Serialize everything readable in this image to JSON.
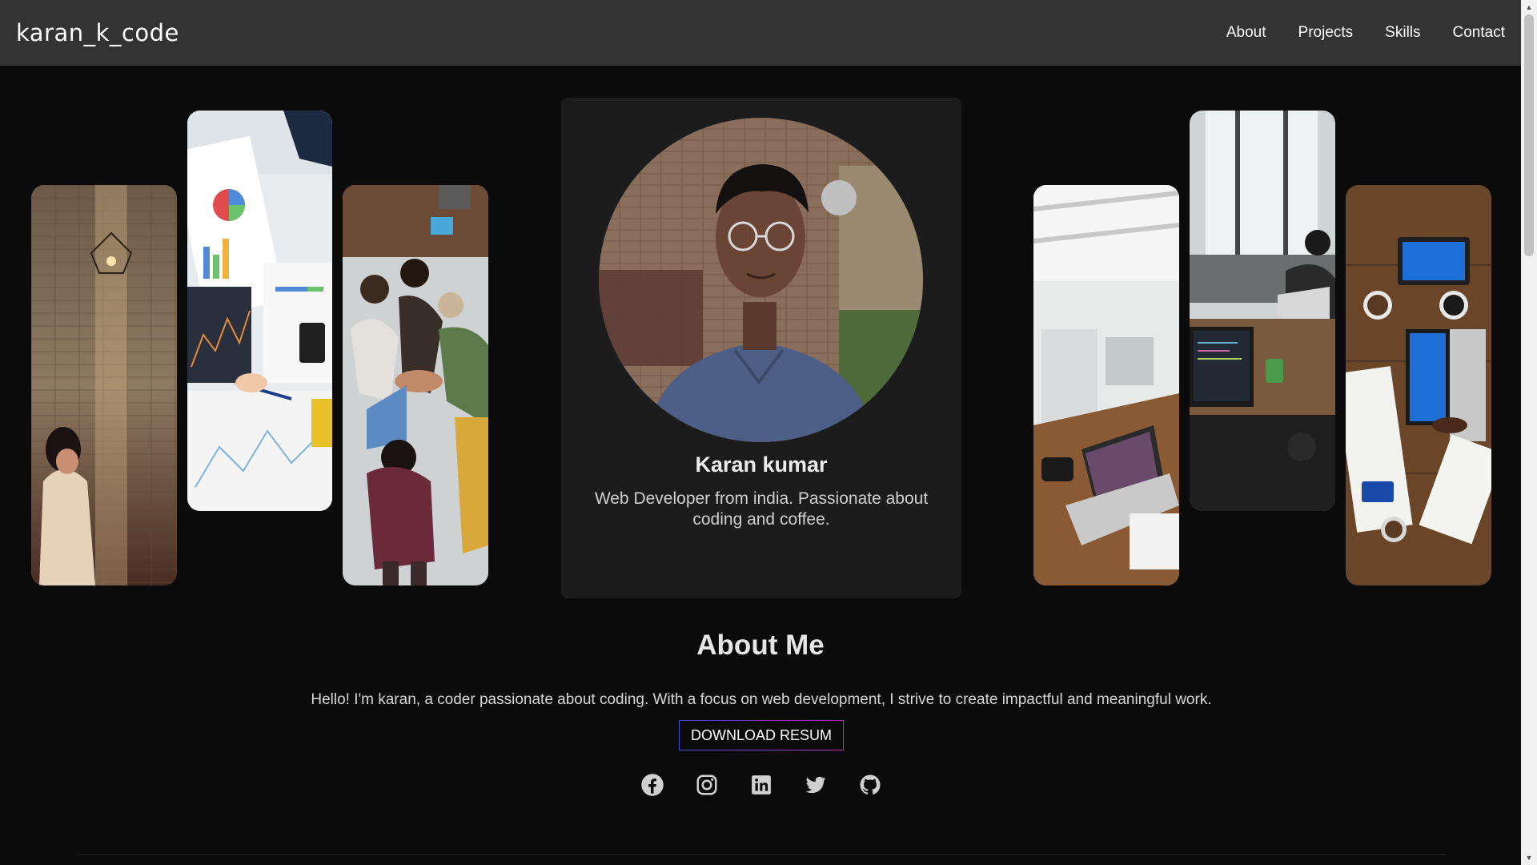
{
  "header": {
    "brand": "karan_k_code",
    "nav": [
      "About",
      "Projects",
      "Skills",
      "Contact"
    ]
  },
  "profile": {
    "name": "Karan kumar",
    "bio": "Web Developer from india. Passionate about coding and coffee."
  },
  "about": {
    "title": "About Me",
    "text": "Hello! I'm karan, a coder passionate about coding. With a focus on web development, I strive to create impactful and meaningful work.",
    "resume_button": "DOWNLOAD RESUM"
  },
  "social_icons": [
    "facebook-icon",
    "instagram-icon",
    "linkedin-icon",
    "twitter-icon",
    "github-icon"
  ],
  "colors": {
    "background": "#0b0b0b",
    "header": "#333333",
    "card": "#1c1c1c",
    "button_border_start": "#4b4bd6",
    "button_border_end": "#c02bb8"
  }
}
